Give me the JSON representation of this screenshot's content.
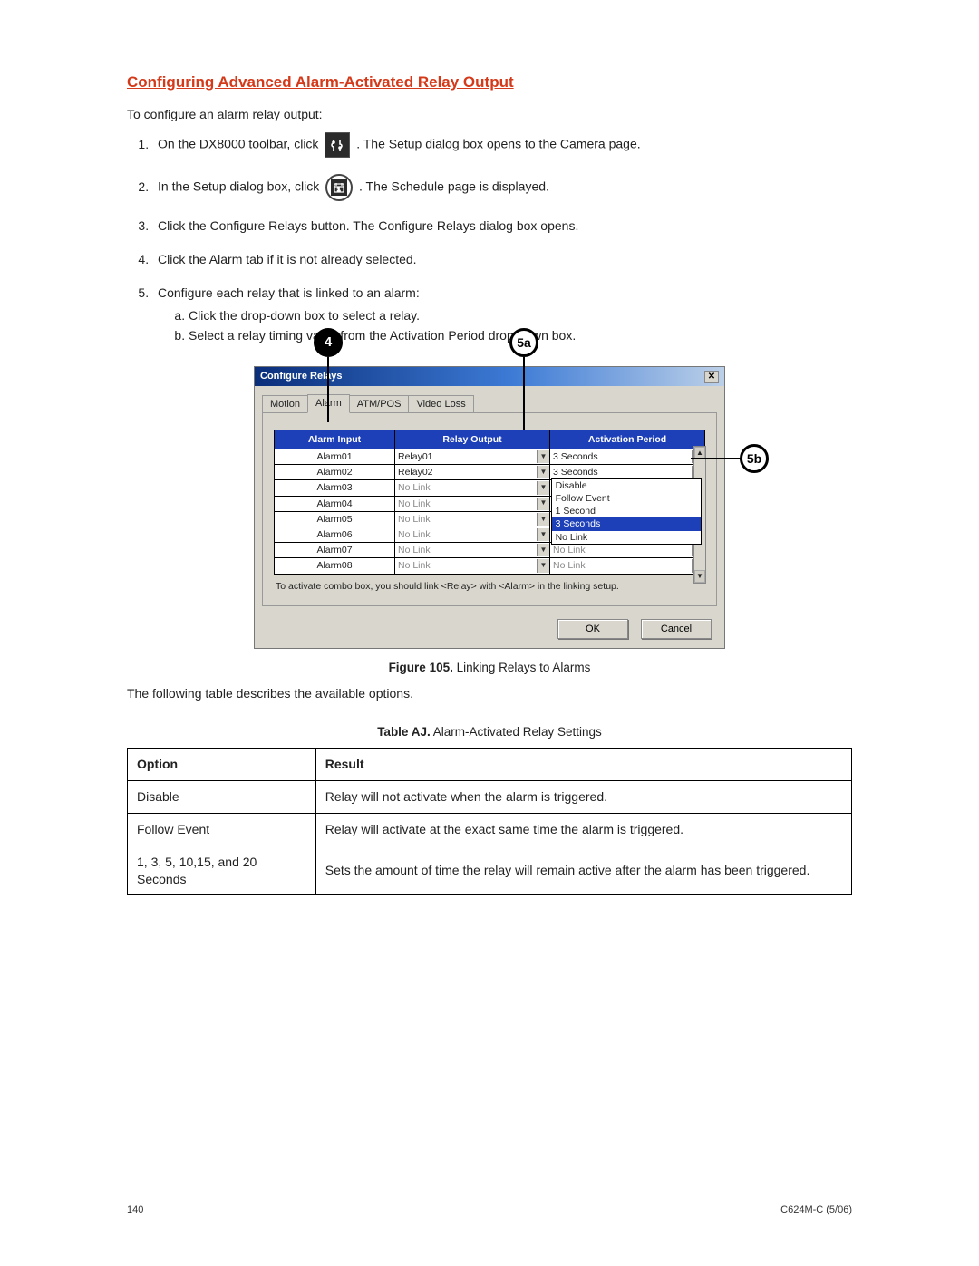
{
  "heading": "Configuring Advanced Alarm-Activated Relay Output",
  "intro": "To configure an alarm relay output:",
  "steps": {
    "s1a": "On the DX8000 toolbar, click",
    "s1b": ". The Setup dialog box opens to the Camera page.",
    "s2a": "In the Setup dialog box, click",
    "s2b": ". The Schedule page is displayed.",
    "s3": "Click the Configure Relays button. The Configure Relays dialog box opens.",
    "s4": "Click the Alarm tab if it is not already selected.",
    "s5": "Configure each relay that is linked to an alarm:",
    "s5a": "Click the drop-down box to select a relay.",
    "s5b": "Select a relay timing value from the Activation Period drop-down box."
  },
  "icons": {
    "setup": "setup-icon",
    "schedule": "schedule-icon"
  },
  "callouts": {
    "c4": "4",
    "c5a": "5a",
    "c5b": "5b"
  },
  "dialog": {
    "title": "Configure Relays",
    "tabs": [
      "Motion",
      "Alarm",
      "ATM/POS",
      "Video Loss"
    ],
    "active_tab": 1,
    "headers": {
      "alarm": "Alarm Input",
      "relay": "Relay Output",
      "period": "Activation Period"
    },
    "rows": [
      {
        "alarm": "Alarm01",
        "relay": "Relay01",
        "relay_disabled": false,
        "period": "3 Seconds",
        "period_disabled": false
      },
      {
        "alarm": "Alarm02",
        "relay": "Relay02",
        "relay_disabled": false,
        "period": "3 Seconds",
        "period_disabled": false
      },
      {
        "alarm": "Alarm03",
        "relay": "No Link",
        "relay_disabled": true,
        "period": "",
        "period_disabled": false,
        "dropdown_open": true
      },
      {
        "alarm": "Alarm04",
        "relay": "No Link",
        "relay_disabled": true,
        "period": "",
        "period_disabled": false
      },
      {
        "alarm": "Alarm05",
        "relay": "No Link",
        "relay_disabled": true,
        "period": "",
        "period_disabled": false
      },
      {
        "alarm": "Alarm06",
        "relay": "No Link",
        "relay_disabled": true,
        "period": "No Link",
        "period_disabled": true
      },
      {
        "alarm": "Alarm07",
        "relay": "No Link",
        "relay_disabled": true,
        "period": "No Link",
        "period_disabled": true
      },
      {
        "alarm": "Alarm08",
        "relay": "No Link",
        "relay_disabled": true,
        "period": "No Link",
        "period_disabled": true
      }
    ],
    "dropdown_options": [
      "Disable",
      "Follow Event",
      "1 Second",
      "3 Seconds",
      "No Link"
    ],
    "dropdown_selected_index": 3,
    "hint": "To activate combo box, you should link <Relay> with <Alarm> in the linking setup.",
    "ok": "OK",
    "cancel": "Cancel"
  },
  "figure": {
    "label": "Figure 105.",
    "text": "  Linking Relays to Alarms"
  },
  "after_figure": "The following table describes the available options.",
  "table_caption": {
    "label": "Table AJ.",
    "text": "  Alarm-Activated Relay Settings"
  },
  "options_table": {
    "head": {
      "option": "Option",
      "result": "Result"
    },
    "rows": [
      {
        "option": "Disable",
        "result": "Relay will not activate when the alarm is triggered."
      },
      {
        "option": "Follow Event",
        "result": "Relay will activate at the exact same time the alarm is triggered."
      },
      {
        "option": "1, 3, 5, 10,15, and 20 Seconds",
        "result": "Sets the amount of time the relay will remain active after the alarm has been triggered."
      }
    ]
  },
  "footer": {
    "page": "140",
    "doc": "C624M-C (5/06)"
  }
}
